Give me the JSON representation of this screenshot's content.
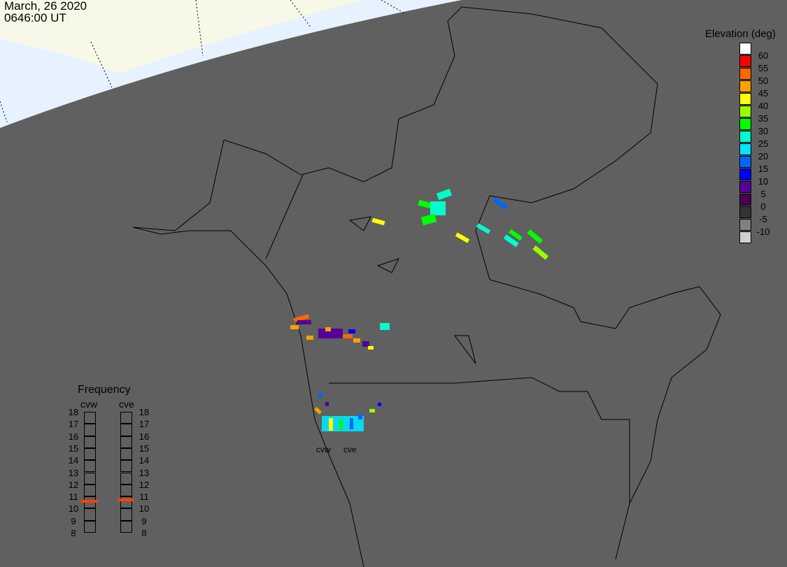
{
  "header": {
    "date": "March, 26 2020",
    "time": "0646:00 UT"
  },
  "colorbar": {
    "title": "Elevation (deg)",
    "labels": [
      "60",
      "55",
      "50",
      "45",
      "40",
      "35",
      "30",
      "25",
      "20",
      "15",
      "10",
      "5",
      "0",
      "-5",
      "-10"
    ],
    "colors": [
      "#ffffff",
      "#ff0000",
      "#ff6600",
      "#ffa000",
      "#ffff00",
      "#99ff00",
      "#00ff00",
      "#00ffcc",
      "#00e5ff",
      "#0066ff",
      "#0000ff",
      "#550099",
      "#4a0050",
      "#333333",
      "#808080",
      "#d0d0d0"
    ]
  },
  "frequency": {
    "title": "Frequency",
    "radars": [
      {
        "name": "cvw",
        "mhz": 10.6
      },
      {
        "name": "cve",
        "mhz": 10.7
      }
    ],
    "ticks": [
      "18",
      "17",
      "16",
      "15",
      "14",
      "13",
      "12",
      "11",
      "10",
      "9",
      "8"
    ],
    "marker_color": "#ff4000"
  },
  "map": {
    "radar_labels": [
      "cvw",
      "cve"
    ],
    "background": "#606060",
    "dayside_color": "#e6f2ff",
    "land_day_color": "#f8f8e8"
  }
}
